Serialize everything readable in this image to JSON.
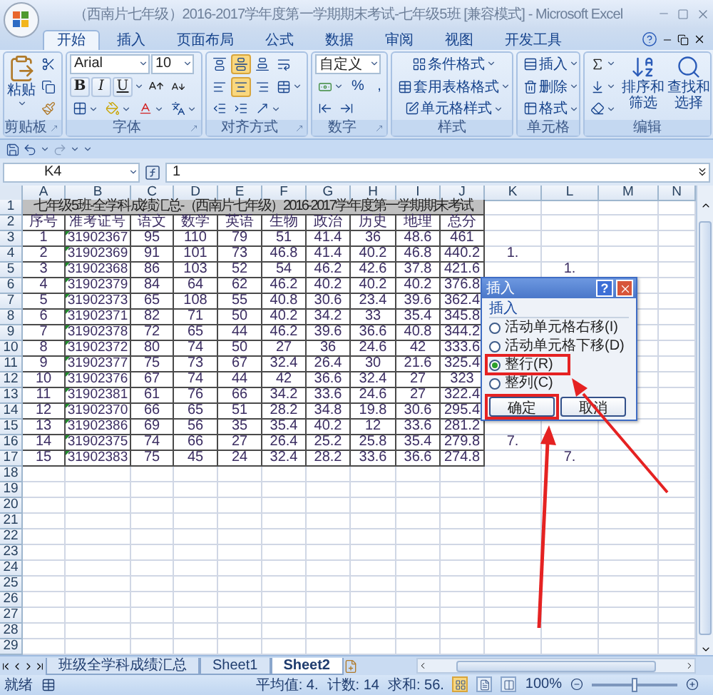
{
  "window": {
    "title": "（西南片七年级）2016-2017学年度第一学期期末考试-七年级5班  [兼容模式] - Microsoft Excel"
  },
  "tabs": [
    {
      "label": "开始",
      "selected": true
    },
    {
      "label": "插入",
      "selected": false
    },
    {
      "label": "页面布局",
      "selected": false
    },
    {
      "label": "公式",
      "selected": false
    },
    {
      "label": "数据",
      "selected": false
    },
    {
      "label": "审阅",
      "selected": false
    },
    {
      "label": "视图",
      "selected": false
    },
    {
      "label": "开发工具",
      "selected": false
    }
  ],
  "ribbon": {
    "clipboard": {
      "label": "剪贴板",
      "paste": "粘贴"
    },
    "font": {
      "label": "字体",
      "font_name": "Arial",
      "font_size": "10",
      "styles": [
        {
          "kind": "bold",
          "label": "B"
        },
        {
          "kind": "italic",
          "label": "I"
        },
        {
          "kind": "underline",
          "label": "U"
        }
      ]
    },
    "alignment": {
      "label": "对齐方式",
      "vertical": [
        {
          "selected": false
        },
        {
          "selected": true
        },
        {
          "selected": false
        }
      ],
      "horizontal": [
        {
          "selected": false
        },
        {
          "selected": true
        },
        {
          "selected": false
        }
      ]
    },
    "number": {
      "label": "数字",
      "format": "自定义",
      "symbols": [
        "%",
        ","
      ]
    },
    "styles": {
      "label": "样式",
      "items": [
        "条件格式",
        "套用表格格式",
        "单元格样式"
      ]
    },
    "cells": {
      "label": "单元格",
      "items": [
        "插入",
        "删除",
        "格式"
      ]
    },
    "editing": {
      "label": "编辑",
      "sort": [
        "排序和",
        "筛选"
      ],
      "find": [
        "查找和",
        "选择"
      ]
    }
  },
  "formula_bar": {
    "name_box": "K4",
    "value": "1"
  },
  "sheet": {
    "columns": [
      "A",
      "B",
      "C",
      "D",
      "E",
      "F",
      "G",
      "H",
      "I",
      "J",
      "K",
      "L",
      "M",
      "N"
    ],
    "title_row": {
      "number": "1",
      "text": "七年级5班-全学科成绩汇总-（西南片七年级）2016-2017学年度第一学期期末考试"
    },
    "rows": [
      {
        "number": "2",
        "cells": [
          "序号",
          "准考证号",
          "语文",
          "数学",
          "英语",
          "生物",
          "政治",
          "历史",
          "地理",
          "总分"
        ]
      },
      {
        "number": "3",
        "cells": [
          "1",
          "31902367",
          "95",
          "110",
          "79",
          "51",
          "41.4",
          "36",
          "48.6",
          "461"
        ]
      },
      {
        "number": "4",
        "cells": [
          "2",
          "31902369",
          "91",
          "101",
          "73",
          "46.8",
          "41.4",
          "40.2",
          "46.8",
          "440.2"
        ],
        "col_k": "1."
      },
      {
        "number": "5",
        "cells": [
          "3",
          "31902368",
          "86",
          "103",
          "52",
          "54",
          "46.2",
          "42.6",
          "37.8",
          "421.6"
        ],
        "col_l": "1."
      },
      {
        "number": "6",
        "cells": [
          "4",
          "31902379",
          "84",
          "64",
          "62",
          "46.2",
          "40.2",
          "40.2",
          "40.2",
          "376.8"
        ]
      },
      {
        "number": "7",
        "cells": [
          "5",
          "31902373",
          "65",
          "108",
          "55",
          "40.8",
          "30.6",
          "23.4",
          "39.6",
          "362.4"
        ]
      },
      {
        "number": "8",
        "cells": [
          "6",
          "31902371",
          "82",
          "71",
          "50",
          "40.2",
          "34.2",
          "33",
          "35.4",
          "345.8"
        ]
      },
      {
        "number": "9",
        "cells": [
          "7",
          "31902378",
          "72",
          "65",
          "44",
          "46.2",
          "39.6",
          "36.6",
          "40.8",
          "344.2"
        ]
      },
      {
        "number": "10",
        "cells": [
          "8",
          "31902372",
          "80",
          "74",
          "50",
          "27",
          "36",
          "24.6",
          "42",
          "333.6"
        ]
      },
      {
        "number": "11",
        "cells": [
          "9",
          "31902377",
          "75",
          "73",
          "67",
          "32.4",
          "26.4",
          "30",
          "21.6",
          "325.4"
        ]
      },
      {
        "number": "12",
        "cells": [
          "10",
          "31902376",
          "67",
          "74",
          "44",
          "42",
          "36.6",
          "32.4",
          "27",
          "323"
        ]
      },
      {
        "number": "13",
        "cells": [
          "11",
          "31902381",
          "61",
          "76",
          "66",
          "34.2",
          "33.6",
          "24.6",
          "27",
          "322.4"
        ]
      },
      {
        "number": "14",
        "cells": [
          "12",
          "31902370",
          "66",
          "65",
          "51",
          "28.2",
          "34.8",
          "19.8",
          "30.6",
          "295.4"
        ]
      },
      {
        "number": "15",
        "cells": [
          "13",
          "31902386",
          "69",
          "56",
          "35",
          "35.4",
          "40.2",
          "12",
          "33.6",
          "281.2"
        ]
      },
      {
        "number": "16",
        "cells": [
          "14",
          "31902375",
          "74",
          "66",
          "27",
          "26.4",
          "25.2",
          "25.8",
          "35.4",
          "279.8"
        ],
        "col_k": "7."
      },
      {
        "number": "17",
        "cells": [
          "15",
          "31902383",
          "75",
          "45",
          "24",
          "32.4",
          "28.2",
          "33.6",
          "36.6",
          "274.8"
        ],
        "col_l": "7."
      },
      {
        "number": "18"
      },
      {
        "number": "19"
      },
      {
        "number": "20"
      },
      {
        "number": "21"
      },
      {
        "number": "22"
      },
      {
        "number": "23"
      },
      {
        "number": "24"
      },
      {
        "number": "25"
      },
      {
        "number": "26"
      },
      {
        "number": "27"
      },
      {
        "number": "28"
      },
      {
        "number": "29"
      }
    ]
  },
  "dialog": {
    "title": "插入",
    "help": "?",
    "group": "插入",
    "options": [
      {
        "label": "活动单元格右移(I)",
        "selected": false
      },
      {
        "label": "活动单元格下移(D)",
        "selected": false
      },
      {
        "label": "整行(R)",
        "selected": true
      },
      {
        "label": "整列(C)",
        "selected": false
      }
    ],
    "buttons": [
      "确定",
      "取消"
    ]
  },
  "sheet_tabs": [
    {
      "label": "班级全学科成绩汇总",
      "selected": false
    },
    {
      "label": "Sheet1",
      "selected": false
    },
    {
      "label": "Sheet2",
      "selected": true
    }
  ],
  "status_bar": {
    "state": "就绪",
    "average": "平均值: 4.",
    "count": "计数: 14",
    "sum": "求和: 56.",
    "view_modes": [
      {
        "selected": true
      },
      {
        "selected": false
      },
      {
        "selected": false
      }
    ],
    "zoom": "100%",
    "zoom_slider": {
      "level": 0.5
    }
  }
}
